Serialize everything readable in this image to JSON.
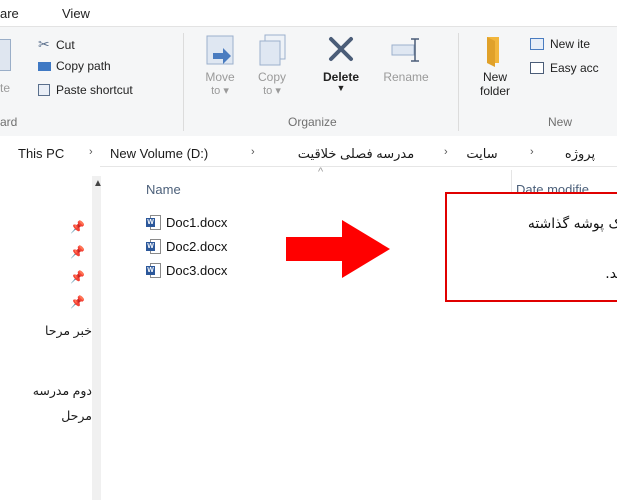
{
  "menu": {
    "share": "are",
    "view": "View"
  },
  "ribbon": {
    "clipboard": {
      "paste_fragment": "te",
      "cut": "Cut",
      "copy_path": "Copy path",
      "paste_shortcut": "Paste shortcut",
      "group_label": "ard"
    },
    "organize": {
      "move_to": "Move",
      "move_to_sub": "to",
      "copy_to": "Copy",
      "copy_to_sub": "to",
      "delete": "Delete",
      "rename": "Rename",
      "group_label": "Organize"
    },
    "new": {
      "new_folder_1": "New",
      "new_folder_2": "folder",
      "new_item": "New ite",
      "easy_access": "Easy acc",
      "group_label": "New"
    }
  },
  "address": {
    "crumbs": [
      "This PC",
      "New Volume (D:)",
      "مدرسه فصلی خلاقیت",
      "سایت",
      "پروژه"
    ]
  },
  "nav": {
    "items": [
      "خبر مرحا",
      "دوم مدرسه",
      "مرحل"
    ]
  },
  "file_list": {
    "column_name": "Name",
    "column_date": "Date modifie",
    "files": [
      {
        "name": "Doc1.docx"
      },
      {
        "name": "Doc2.docx"
      },
      {
        "name": "Doc3.docx"
      }
    ]
  },
  "annotation": {
    "line1": "ک پوشه گذاشته",
    "line2": "ند.",
    "border_color": "#e00000",
    "arrow_color": "#ff0000"
  },
  "colors": {
    "ribbon_bg": "#f5f6f7",
    "word_icon": "#2b579a",
    "folder": "#f2b63c",
    "header_text": "#4c607a"
  }
}
